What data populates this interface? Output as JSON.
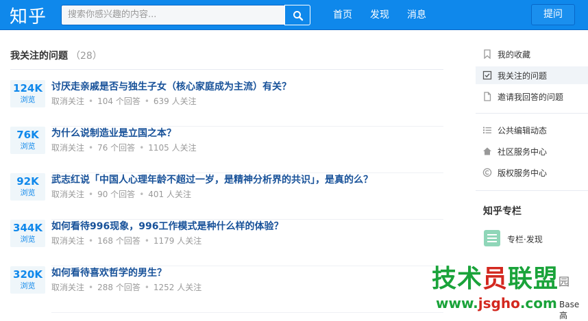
{
  "header": {
    "logo": "知乎",
    "search_placeholder": "搜索你感兴趣的内容...",
    "nav": [
      "首页",
      "发现",
      "消息"
    ],
    "ask_label": "提问"
  },
  "main": {
    "title": "我关注的问题",
    "count": "（28）",
    "questions": [
      {
        "views": "124K",
        "views_label": "浏览",
        "title": "讨厌走亲戚是否与独生子女（核心家庭成为主流）有关？",
        "unfollow": "取消关注",
        "answers": "104 个回答",
        "followers": "639 人关注"
      },
      {
        "views": "76K",
        "views_label": "浏览",
        "title": "为什么说制造业是立国之本？",
        "unfollow": "取消关注",
        "answers": "76 个回答",
        "followers": "1105 人关注"
      },
      {
        "views": "92K",
        "views_label": "浏览",
        "title": "武志红说「中国人心理年龄不超过一岁，是精神分析界的共识」，是真的么？",
        "unfollow": "取消关注",
        "answers": "90 个回答",
        "followers": "401 人关注"
      },
      {
        "views": "344K",
        "views_label": "浏览",
        "title": "如何看待996现象，996工作模式是种什么样的体验？",
        "unfollow": "取消关注",
        "answers": "168 个回答",
        "followers": "1179 人关注"
      },
      {
        "views": "320K",
        "views_label": "浏览",
        "title": "如何看待喜欢哲学的男生？",
        "unfollow": "取消关注",
        "answers": "288 个回答",
        "followers": "1252 人关注"
      }
    ]
  },
  "sidebar": {
    "group1": [
      {
        "label": "我的收藏",
        "icon": "bookmark-icon"
      },
      {
        "label": "我关注的问题",
        "icon": "checkbox-icon",
        "active": true
      },
      {
        "label": "邀请我回答的问题",
        "icon": "document-icon"
      }
    ],
    "group2": [
      {
        "label": "公共编辑动态",
        "icon": "list-icon"
      },
      {
        "label": "社区服务中心",
        "icon": "home-icon"
      },
      {
        "label": "版权服务中心",
        "icon": "copyright-icon"
      }
    ],
    "column_title": "知乎专栏",
    "column_item": "专栏·发现"
  },
  "watermark": {
    "text_a": "技术",
    "text_b": "员",
    "text_c": "联盟",
    "url_a": "www.",
    "url_b": "jsgho",
    "url_c": ".com",
    "extra": "园",
    "tag": "Base 高"
  },
  "colors": {
    "header_bg": "#0f88eb",
    "link_title": "#175199",
    "views_accent": "#0f88eb"
  }
}
